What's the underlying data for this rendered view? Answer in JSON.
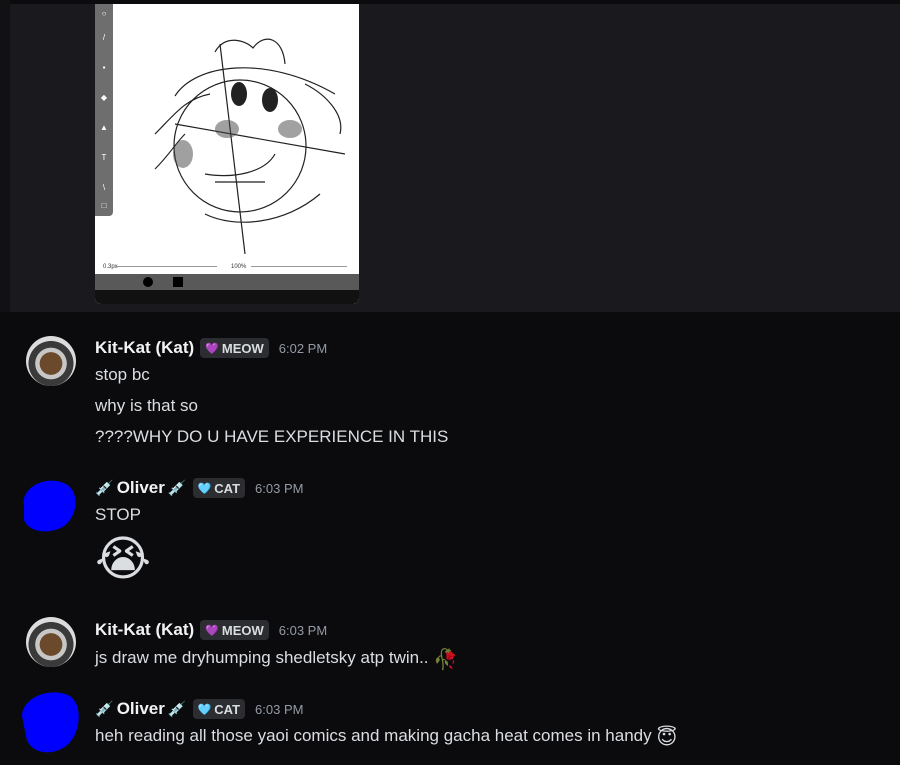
{
  "attachment": {
    "app_bottom": {
      "brush_size": "0.3px",
      "opacity": "100%"
    }
  },
  "messages": [
    {
      "author": "Kit-Kat (Kat)",
      "tag": "MEOW",
      "tag_color": "#b69cff",
      "time": "6:02 PM",
      "lines": [
        "stop bc",
        "why is that so",
        "????WHY DO U HAVE EXPERIENCE IN THIS"
      ]
    },
    {
      "author": "Oliver",
      "author_prefix": "💉",
      "author_suffix": "💉",
      "tag": "CAT",
      "tag_color": "#7dd3fc",
      "time": "6:03 PM",
      "lines": [
        "STOP"
      ],
      "emoji": "😭"
    },
    {
      "author": "Kit-Kat (Kat)",
      "tag": "MEOW",
      "tag_color": "#b69cff",
      "time": "6:03 PM",
      "lines": [
        "js draw me dryhumping shedletsky atp twin.."
      ],
      "line_emoji": "🥀"
    },
    {
      "author": "Oliver",
      "author_prefix": "💉",
      "author_suffix": "💉",
      "tag": "CAT",
      "tag_color": "#7dd3fc",
      "time": "6:03 PM",
      "lines": [
        "heh reading all those yaoi comics and making gacha heat comes in handy"
      ],
      "line_emoji": "😇"
    }
  ]
}
